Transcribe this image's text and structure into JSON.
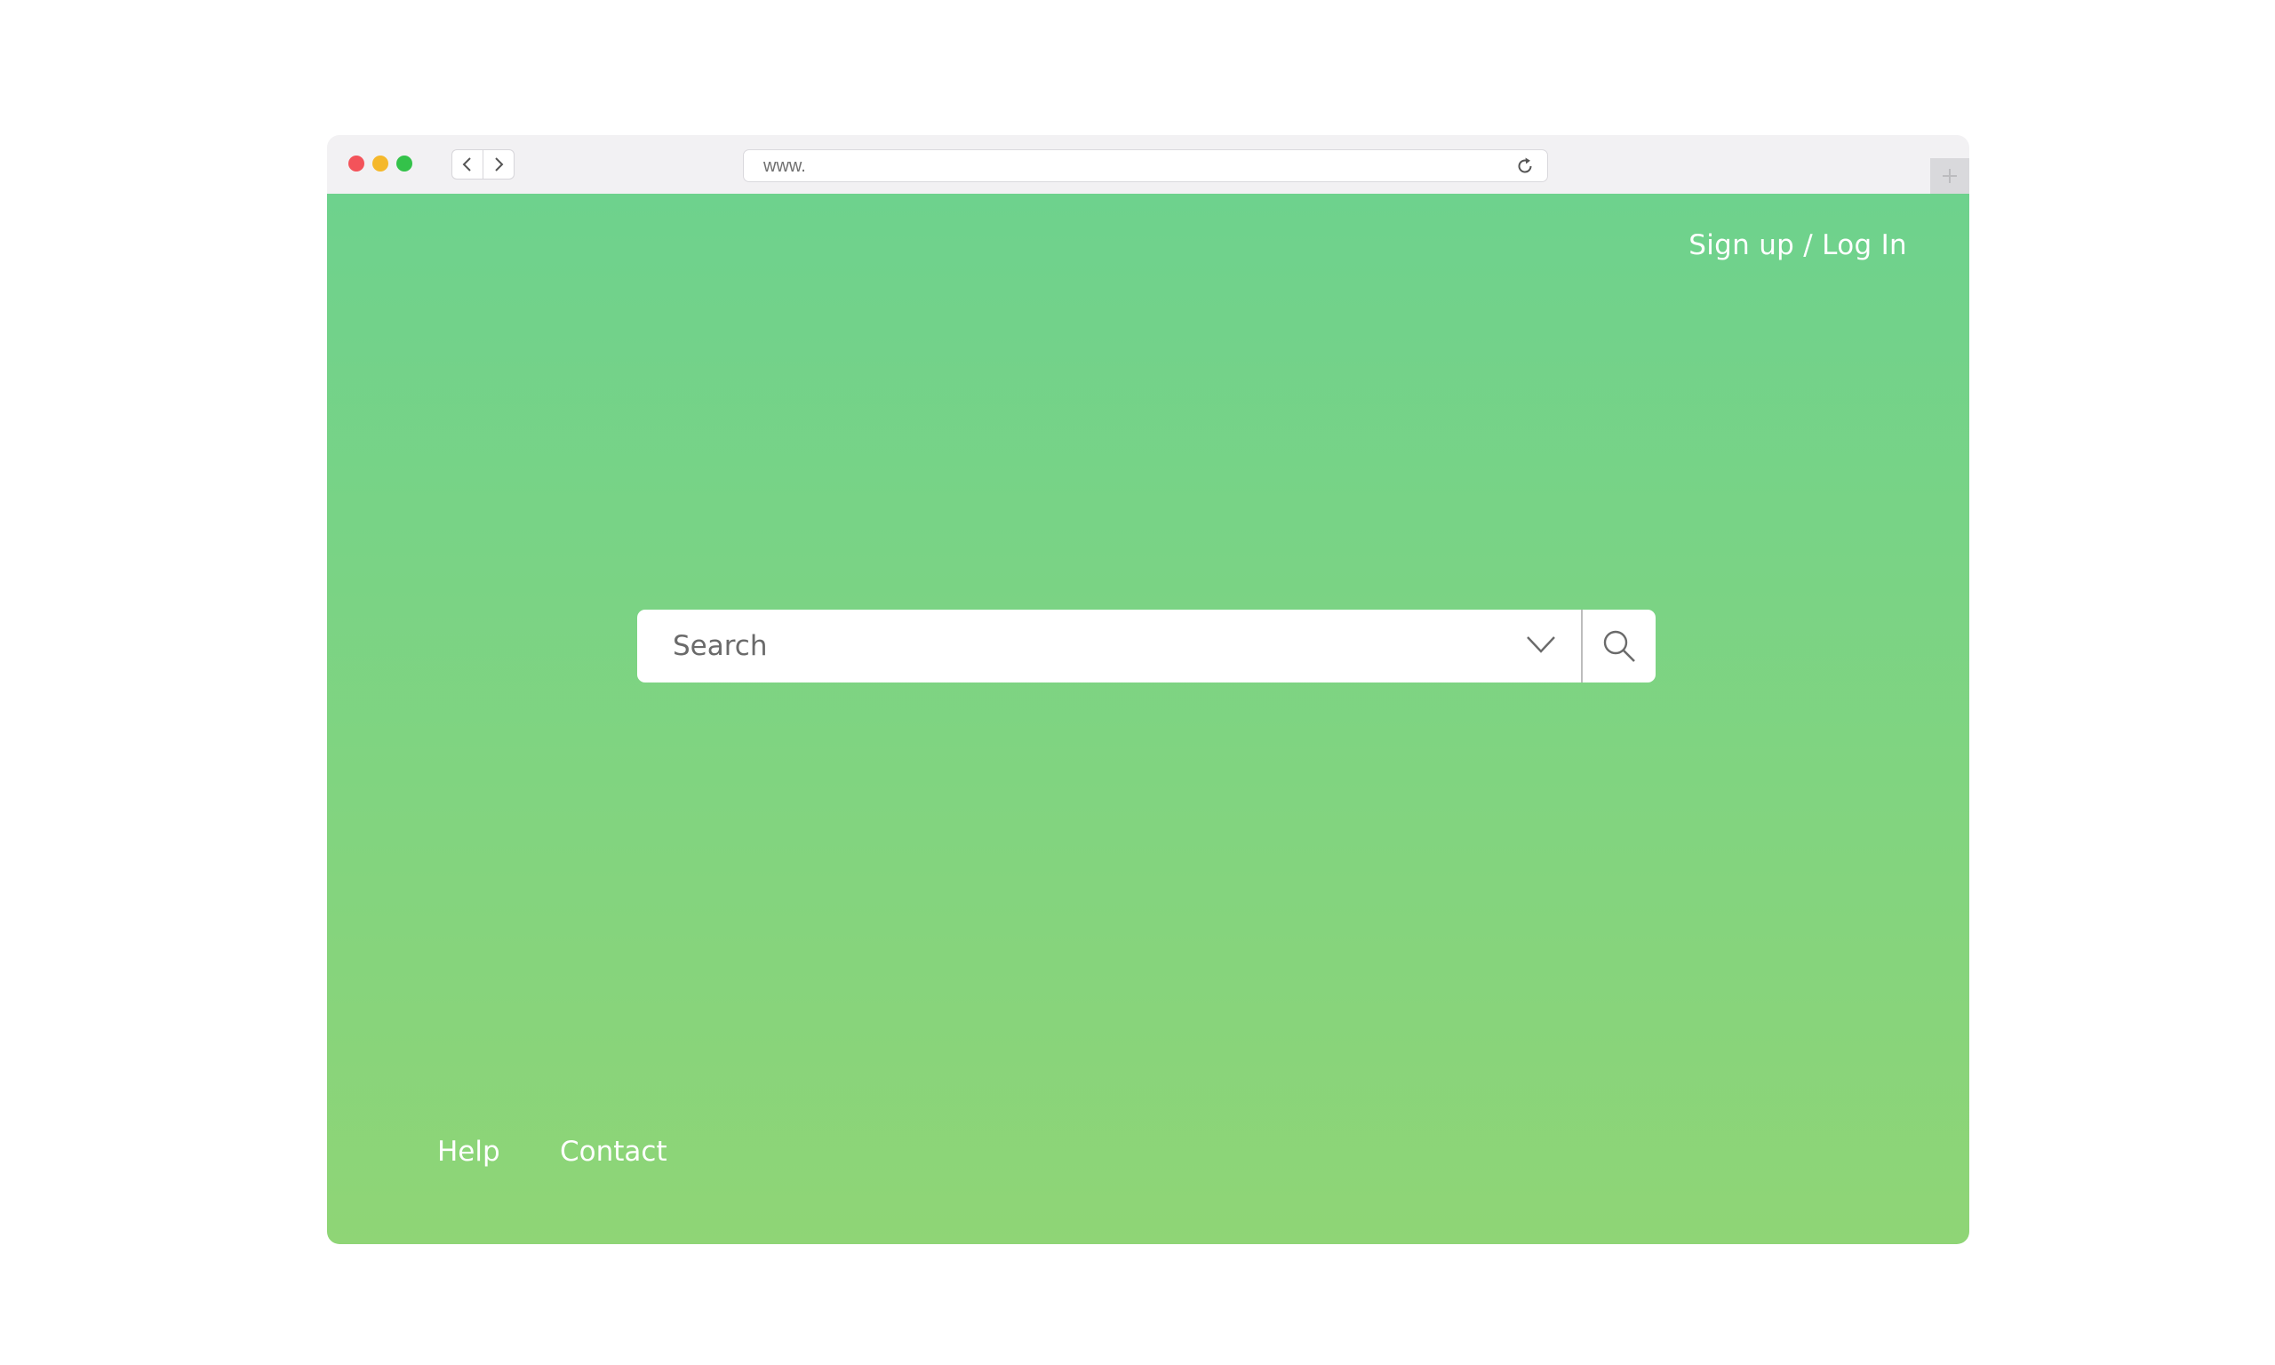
{
  "browser": {
    "address_bar": {
      "value": "www."
    },
    "icons": {
      "back": "chevron-left-icon",
      "forward": "chevron-right-icon",
      "reload": "reload-icon",
      "new_tab": "plus-icon"
    }
  },
  "header": {
    "auth_link": "Sign up / Log In"
  },
  "search": {
    "placeholder": "Search",
    "icons": {
      "dropdown": "chevron-down-icon",
      "submit": "search-icon"
    }
  },
  "footer": {
    "links": [
      "Help",
      "Contact"
    ]
  },
  "colors": {
    "gradient_top": "#6ed28d",
    "gradient_bottom": "#8fd576",
    "traffic_red": "#f3535a",
    "traffic_yellow": "#f5b82b",
    "traffic_green": "#34c24a"
  }
}
